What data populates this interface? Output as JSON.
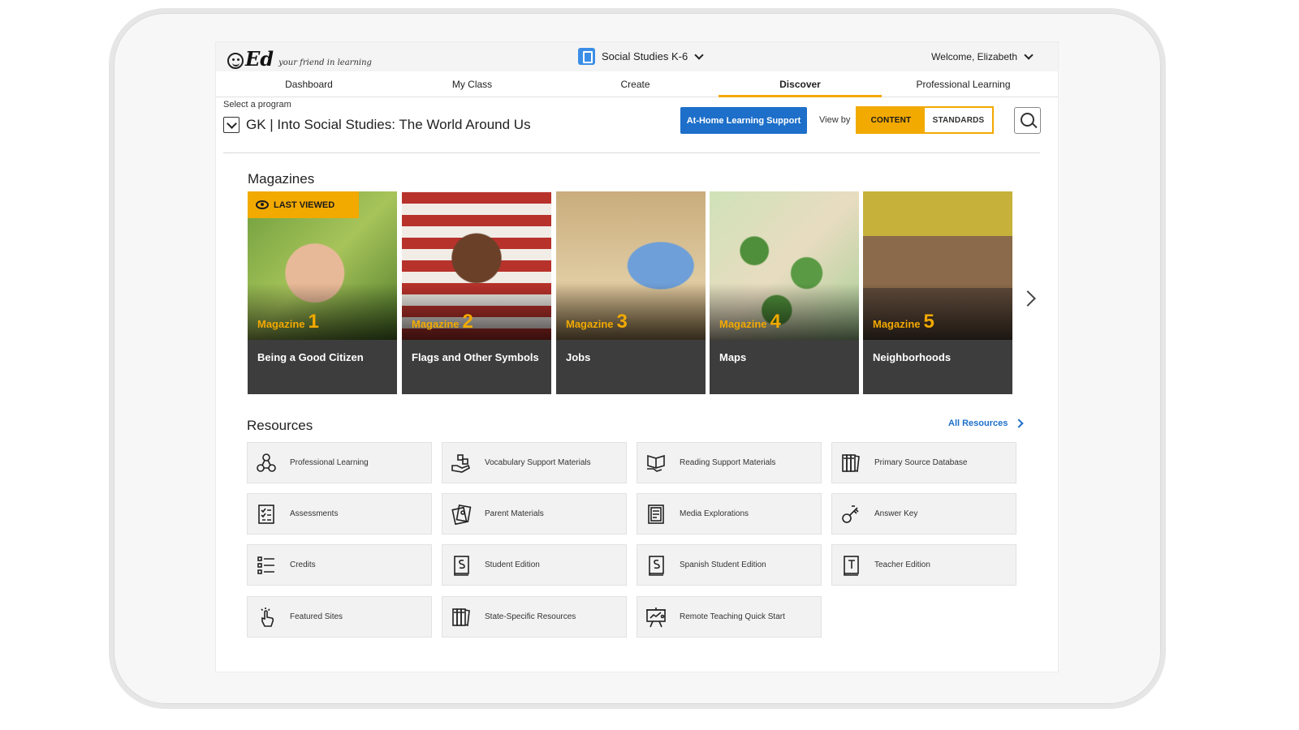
{
  "header": {
    "logo_text": "Ed",
    "logo_tagline": "your friend in learning",
    "subject": "Social Studies K-6",
    "welcome": "Welcome, Elizabeth"
  },
  "nav": {
    "items": [
      {
        "label": "Dashboard"
      },
      {
        "label": "My Class"
      },
      {
        "label": "Create"
      },
      {
        "label": "Discover",
        "active": true
      },
      {
        "label": "Professional Learning"
      }
    ]
  },
  "program": {
    "select_label": "Select a program",
    "title": "GK | Into Social Studies: The World Around Us",
    "home_button": "At-Home Learning Support",
    "view_by_label": "View by",
    "view_options": [
      "CONTENT",
      "STANDARDS"
    ],
    "view_selected": "CONTENT"
  },
  "magazines": {
    "heading": "Magazines",
    "badge": "LAST VIEWED",
    "cards": [
      {
        "word": "Magazine",
        "number": "1",
        "title": "Being a Good Citizen",
        "bg": "#7aa04a"
      },
      {
        "word": "Magazine",
        "number": "2",
        "title": "Flags and Other Symbols",
        "bg": "#a8453c"
      },
      {
        "word": "Magazine",
        "number": "3",
        "title": "Jobs",
        "bg": "#c7a574"
      },
      {
        "word": "Magazine",
        "number": "4",
        "title": "Maps",
        "bg": "#9bc28a"
      },
      {
        "word": "Magazine",
        "number": "5",
        "title": "Neighborhoods",
        "bg": "#8a7a3c"
      }
    ]
  },
  "resources": {
    "heading": "Resources",
    "all_link": "All Resources",
    "tiles": [
      {
        "label": "Professional Learning",
        "icon": "network-icon"
      },
      {
        "label": "Vocabulary Support Materials",
        "icon": "hand-blocks-icon"
      },
      {
        "label": "Reading Support Materials",
        "icon": "open-book-hand-icon"
      },
      {
        "label": "Primary Source Database",
        "icon": "books-icon"
      },
      {
        "label": "Assessments",
        "icon": "checklist-icon"
      },
      {
        "label": "Parent Materials",
        "icon": "papers-icon"
      },
      {
        "label": "Media Explorations",
        "icon": "document-icon"
      },
      {
        "label": "Answer Key",
        "icon": "key-icon"
      },
      {
        "label": "Credits",
        "icon": "list-icon"
      },
      {
        "label": "Student Edition",
        "icon": "book-s-icon"
      },
      {
        "label": "Spanish Student Edition",
        "icon": "book-s-icon"
      },
      {
        "label": "Teacher Edition",
        "icon": "book-t-icon"
      },
      {
        "label": "Featured Sites",
        "icon": "pointer-hand-icon"
      },
      {
        "label": "State-Specific Resources",
        "icon": "books-icon"
      },
      {
        "label": "Remote Teaching Quick Start",
        "icon": "presentation-icon"
      }
    ]
  },
  "colors": {
    "accent": "#f2a900",
    "primary": "#1d6fc9",
    "card_bg": "#3d3d3d"
  }
}
